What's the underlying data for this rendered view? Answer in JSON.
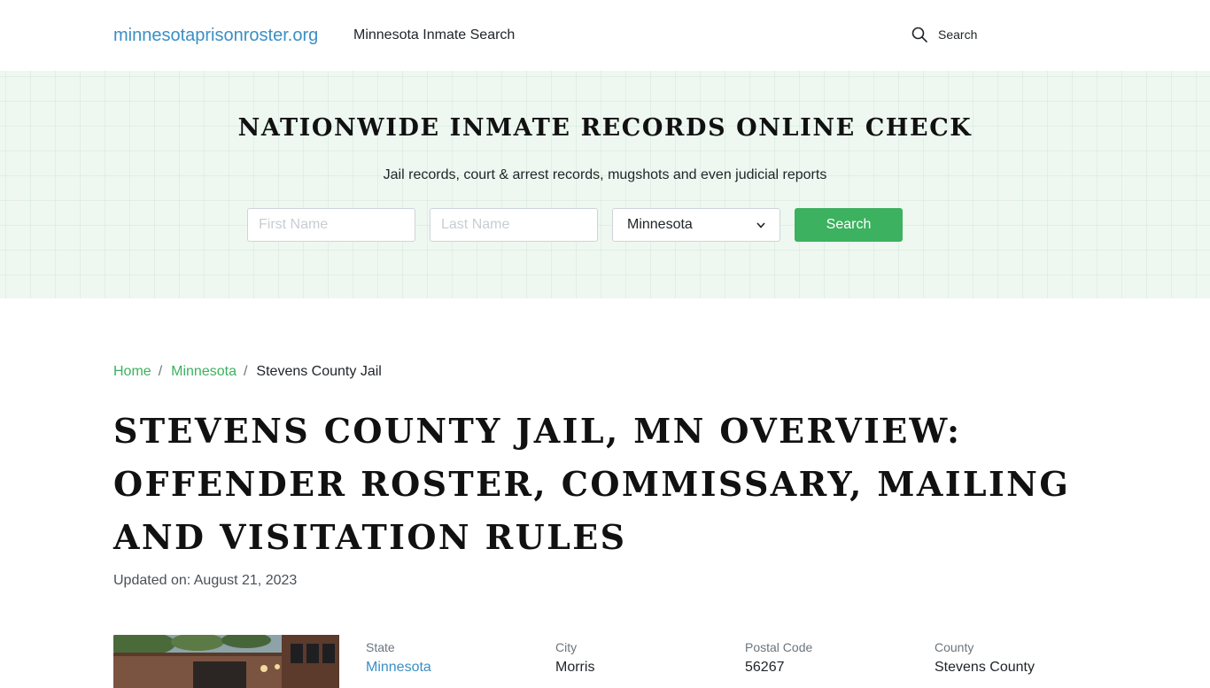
{
  "header": {
    "brand": "minnesotaprisonroster.org",
    "nav_link": "Minnesota Inmate Search",
    "search_label": "Search"
  },
  "hero": {
    "title": "NATIONWIDE INMATE RECORDS ONLINE CHECK",
    "subtitle": "Jail records, court & arrest records, mugshots and even judicial reports",
    "first_name_placeholder": "First Name",
    "last_name_placeholder": "Last Name",
    "state_selected": "Minnesota",
    "search_button": "Search"
  },
  "breadcrumb": {
    "home": "Home",
    "state": "Minnesota",
    "current": "Stevens County Jail",
    "separator": "/"
  },
  "page": {
    "title": "Stevens County Jail, MN Overview: Offender Roster, Commissary, Mailing and Visitation Rules",
    "updated": "Updated on: August 21, 2023"
  },
  "facility": {
    "state_label": "State",
    "state_value": "Minnesota",
    "city_label": "City",
    "city_value": "Morris",
    "postal_label": "Postal Code",
    "postal_value": "56267",
    "county_label": "County",
    "county_value": "Stevens County"
  },
  "colors": {
    "brand_blue": "#3a8fc4",
    "accent_green": "#3cb15f",
    "hero_bg": "#eef8f1"
  }
}
